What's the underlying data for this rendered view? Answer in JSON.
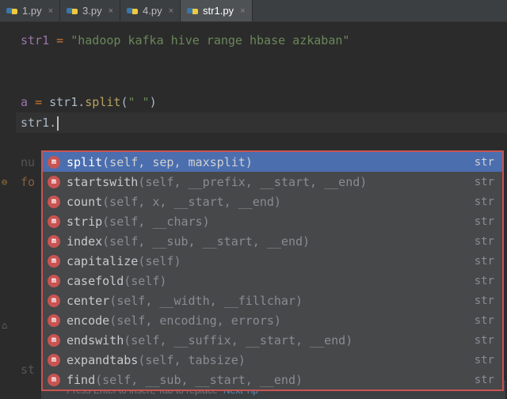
{
  "tabs": [
    {
      "name": "1.py",
      "active": false
    },
    {
      "name": "3.py",
      "active": false
    },
    {
      "name": "4.py",
      "active": false
    },
    {
      "name": "str1.py",
      "active": true
    }
  ],
  "code": {
    "line1_var": "str1 ",
    "line1_eq": "= ",
    "line1_str": "\"hadoop kafka hive range hbase azkaban\"",
    "line3_var": "a ",
    "line3_eq": "= ",
    "line3_obj": "str1",
    "line3_dot": ".",
    "line3_method": "split",
    "line3_paren_open": "(",
    "line3_arg": "\" \"",
    "line3_paren_close": ")",
    "line4_obj": "str1",
    "line4_dot": "."
  },
  "faded": {
    "num": "nu",
    "for": "fo",
    "st": "st"
  },
  "completions": [
    {
      "name": "split",
      "params": "(self, sep, maxsplit)",
      "type": "str",
      "selected": true
    },
    {
      "name": "startswith",
      "params": "(self, __prefix, __start, __end)",
      "type": "str",
      "selected": false
    },
    {
      "name": "count",
      "params": "(self, x, __start, __end)",
      "type": "str",
      "selected": false
    },
    {
      "name": "strip",
      "params": "(self, __chars)",
      "type": "str",
      "selected": false
    },
    {
      "name": "index",
      "params": "(self, __sub, __start, __end)",
      "type": "str",
      "selected": false
    },
    {
      "name": "capitalize",
      "params": "(self)",
      "type": "str",
      "selected": false
    },
    {
      "name": "casefold",
      "params": "(self)",
      "type": "str",
      "selected": false
    },
    {
      "name": "center",
      "params": "(self, __width, __fillchar)",
      "type": "str",
      "selected": false
    },
    {
      "name": "encode",
      "params": "(self, encoding, errors)",
      "type": "str",
      "selected": false
    },
    {
      "name": "endswith",
      "params": "(self, __suffix, __start, __end)",
      "type": "str",
      "selected": false
    },
    {
      "name": "expandtabs",
      "params": "(self, tabsize)",
      "type": "str",
      "selected": false
    },
    {
      "name": "find",
      "params": "(self, __sub, __start, __end)",
      "type": "str",
      "selected": false
    }
  ],
  "hint": {
    "text": "Press Enter to insert, Tab to replace",
    "link": "Next Tip"
  }
}
